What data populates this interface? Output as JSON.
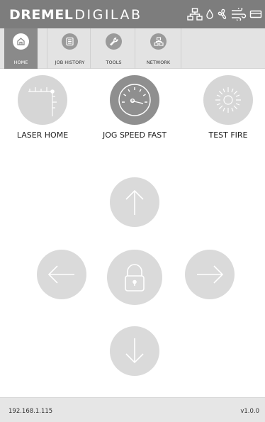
{
  "brand": {
    "name_bold": "DREMEL",
    "name_light": "DIGILAB"
  },
  "status_icons": [
    "network-icon",
    "water-drop-icon",
    "fan-icon",
    "air-flow-icon",
    "card-icon"
  ],
  "tabs": [
    {
      "label": "HOME",
      "icon": "home-icon",
      "active": true
    },
    {
      "label": "JOB HISTORY",
      "icon": "list-icon",
      "active": false
    },
    {
      "label": "TOOLS",
      "icon": "wrench-icon",
      "active": false
    },
    {
      "label": "NETWORK",
      "icon": "network-icon",
      "active": false
    }
  ],
  "actions": {
    "laser_home": {
      "label": "LASER HOME",
      "icon": "laser-home-icon"
    },
    "jog_speed": {
      "label": "JOG SPEED FAST",
      "icon": "speedometer-icon"
    },
    "test_fire": {
      "label": "TEST FIRE",
      "icon": "sunburst-icon"
    }
  },
  "jog_pad": {
    "up": "arrow-up-icon",
    "left": "arrow-left-icon",
    "center": "lock-icon",
    "right": "arrow-right-icon",
    "down": "arrow-down-icon"
  },
  "footer": {
    "ip": "192.168.1.115",
    "version": "v1.0.0"
  },
  "colors": {
    "topbar": "#7d7d7d",
    "navbar": "#e3e3e3",
    "active_tab": "#8a8a8a",
    "button_light": "#d6d6d6",
    "button_dark": "#8f8f8f",
    "footer": "#e6e6e6"
  }
}
